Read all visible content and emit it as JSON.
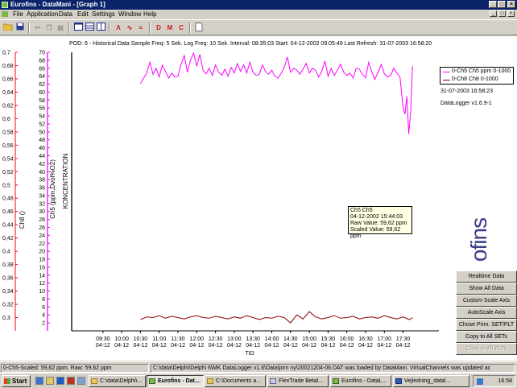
{
  "window": {
    "title": "Eurofins - DataMani - [Graph 1]",
    "controls": [
      "_",
      "□",
      "×"
    ]
  },
  "menu": [
    "File",
    "Application",
    "Data",
    "Edit",
    "Settings",
    "Window",
    "Help"
  ],
  "toolbar": {
    "buttons": [
      "open-folder-icon",
      "save-icon",
      "cut-icon",
      "copy-icon",
      "paste-icon",
      "select-icon",
      "graph-window-icon",
      "table-window-icon",
      "list-window-icon",
      "graph-a-icon",
      "graph-b-icon",
      "scale-icon"
    ],
    "letters": [
      "D",
      "M",
      "C"
    ],
    "letter_colors": [
      "#d01818",
      "#d01818",
      "#d01818"
    ]
  },
  "info_line": "POD: 6 - Historical Data   Sample Freq: 5 Sek.   Log Freq: 10 Sek.   Interval: 08:35:03   Start: 04-12-2002 09:05:49   Last Refresh: 31-07-2003 16:58:20",
  "legend": {
    "items": [
      {
        "label": "0-Ch5 Ch5 ppm 0-1000",
        "color": "#ff00ff"
      },
      {
        "label": "0-Ch8 Ch8 0-1000",
        "color": "#8b0000"
      }
    ]
  },
  "timestamp": "31-07-2003 16:58:23",
  "version": "DataLogger v1.6.9-1",
  "tooltip": {
    "line1": "Ch5 Ch5",
    "line2": "04-12-2002 15:44:03",
    "line3": "Raw Value: 59,62 ppm",
    "line4": "Scaled Value: 59,62 ppm"
  },
  "logo_text": "ofins",
  "panel_buttons": [
    {
      "label": "Realtime Data",
      "enabled": true
    },
    {
      "label": "Show All Data",
      "enabled": true
    },
    {
      "label": "Custom Scale Axis",
      "enabled": true
    },
    {
      "label": "AutoScale Axis",
      "enabled": true
    },
    {
      "label": "Chose Prim. SET/PLT",
      "enabled": true
    },
    {
      "label": "Copy to All SETs",
      "enabled": true
    },
    {
      "label": "Copy to All PLTs",
      "enabled": false
    }
  ],
  "status": {
    "left": "0-Ch5-Scaled: 59,62 ppm, Raw: 59,62 ppm",
    "right": "C:\\data\\Delphi\\Delphi 6\\MK DataLogger v1.6\\Data\\jorn ny\\20021204-06.DAT was loaded by DataMani.  VirtualChannels was updated ac"
  },
  "taskbar": {
    "start": "Start",
    "tasks": [
      {
        "label": "C:\\data\\Delphi\\...",
        "active": false
      },
      {
        "label": "Eurofins - Dat...",
        "active": true
      },
      {
        "label": "C:\\Documents a...",
        "active": false
      },
      {
        "label": "FlexTrade Betal...",
        "active": false
      },
      {
        "label": "Eurofins - DataL...",
        "active": false
      },
      {
        "label": "Vejledning_datal...",
        "active": false
      }
    ],
    "clock": "16:58"
  },
  "chart_data": {
    "type": "line",
    "xlabel": "TID",
    "x_ticks": [
      "09:30\n04-12",
      "10:00\n04-12",
      "10:30\n04-12",
      "11:00\n04-12",
      "11:30\n04-12",
      "12:00\n04-12",
      "12:30\n04-12",
      "13:00\n04-12",
      "13:30\n04-12",
      "14:00\n04-12",
      "14:30\n04-12",
      "15:00\n04-12",
      "15:30\n04-12",
      "16:00\n04-12",
      "16:30\n04-12",
      "17:00\n04-12",
      "17:30\n04-12"
    ],
    "x_range_minutes": [
      520,
      1075
    ],
    "axes": [
      {
        "label": "Ch8 ()",
        "color": "#ff0000",
        "ylim": [
          0.28,
          0.7
        ],
        "ticks": [
          "0,7",
          "0,68",
          "0,66",
          "0,64",
          "0,62",
          "0,6",
          "0,58",
          "0,56",
          "0,54",
          "0,52",
          "0,5",
          "0,48",
          "0,46",
          "0,44",
          "0,42",
          "0,4",
          "0,38",
          "0,36",
          "0,34",
          "0,32",
          "0,3"
        ]
      },
      {
        "label": "Ch5 (ppm,Dvol%O2)",
        "color": "#ff00ff",
        "ylim": [
          0,
          70
        ],
        "ticks": [
          "70",
          "68",
          "66",
          "64",
          "62",
          "60",
          "58",
          "56",
          "54",
          "52",
          "50",
          "48",
          "46",
          "44",
          "42",
          "40",
          "38",
          "36",
          "34",
          "32",
          "30",
          "28",
          "26",
          "24",
          "22",
          "20",
          "18",
          "16",
          "14",
          "12",
          "10",
          "8",
          "6",
          "4",
          "2"
        ]
      },
      {
        "label": "KONCENTRATION",
        "color": "#000000"
      }
    ],
    "series": [
      {
        "name": "0-Ch5 Ch5 ppm 0-1000",
        "color": "#ff00ff",
        "x_minutes": [
          630,
          635,
          640,
          645,
          650,
          655,
          660,
          665,
          670,
          675,
          680,
          685,
          690,
          695,
          700,
          705,
          710,
          715,
          720,
          725,
          730,
          735,
          740,
          745,
          750,
          755,
          760,
          765,
          770,
          775,
          780,
          785,
          790,
          795,
          800,
          805,
          810,
          815,
          820,
          825,
          830,
          835,
          840,
          845,
          850,
          855,
          860,
          865,
          870,
          875,
          880,
          885,
          890,
          895,
          900,
          905,
          910,
          915,
          920,
          925,
          930,
          935,
          940,
          945,
          950,
          955,
          960,
          965,
          970,
          975,
          980,
          985,
          990,
          995,
          1000,
          1005,
          1010,
          1015,
          1020,
          1025,
          1030,
          1035,
          1040,
          1045,
          1050,
          1053,
          1056,
          1059,
          1062,
          1065
        ],
        "values": [
          62.2,
          63.5,
          64.8,
          67.5,
          64.5,
          66.0,
          63.8,
          66.8,
          65.2,
          63.5,
          64.8,
          63.8,
          64.0,
          67.0,
          69.2,
          65.0,
          68.0,
          69.8,
          66.5,
          69.5,
          65.5,
          64.6,
          66.0,
          64.2,
          66.8,
          65.0,
          64.2,
          65.8,
          64.0,
          66.2,
          64.8,
          67.2,
          65.2,
          66.8,
          64.8,
          67.5,
          65.0,
          64.2,
          64.5,
          66.8,
          65.2,
          64.5,
          65.5,
          64.0,
          63.5,
          64.8,
          66.2,
          68.8,
          65.0,
          66.0,
          65.5,
          64.5,
          65.8,
          67.2,
          64.8,
          66.0,
          65.5,
          63.8,
          65.2,
          67.8,
          64.0,
          66.0,
          64.2,
          65.5,
          67.0,
          65.0,
          64.2,
          64.8,
          63.5,
          66.0,
          65.8,
          64.5,
          63.6,
          67.5,
          65.0,
          63.2,
          65.0,
          67.0,
          64.6,
          63.8,
          64.2,
          66.0,
          64.8,
          63.8,
          56.0,
          54.5,
          59.0,
          49.5,
          55.0,
          66.5
        ]
      },
      {
        "name": "0-Ch8 Ch8 0-1000",
        "color": "#8b0000",
        "x_minutes": [
          630,
          640,
          650,
          660,
          670,
          680,
          690,
          700,
          710,
          720,
          730,
          740,
          750,
          760,
          770,
          780,
          790,
          800,
          810,
          820,
          830,
          840,
          850,
          860,
          870,
          880,
          890,
          900,
          910,
          920,
          930,
          940,
          950,
          960,
          970,
          980,
          990,
          1000,
          1010,
          1020,
          1030,
          1040,
          1050,
          1060,
          1065
        ],
        "values": [
          0.297,
          0.301,
          0.3,
          0.303,
          0.299,
          0.302,
          0.3,
          0.298,
          0.301,
          0.303,
          0.3,
          0.299,
          0.302,
          0.3,
          0.298,
          0.301,
          0.299,
          0.303,
          0.3,
          0.297,
          0.3,
          0.299,
          0.302,
          0.3,
          0.292,
          0.304,
          0.298,
          0.309,
          0.301,
          0.298,
          0.3,
          0.303,
          0.299,
          0.3,
          0.302,
          0.298,
          0.3,
          0.301,
          0.299,
          0.303,
          0.3,
          0.298,
          0.301,
          0.297,
          0.3
        ]
      }
    ]
  }
}
